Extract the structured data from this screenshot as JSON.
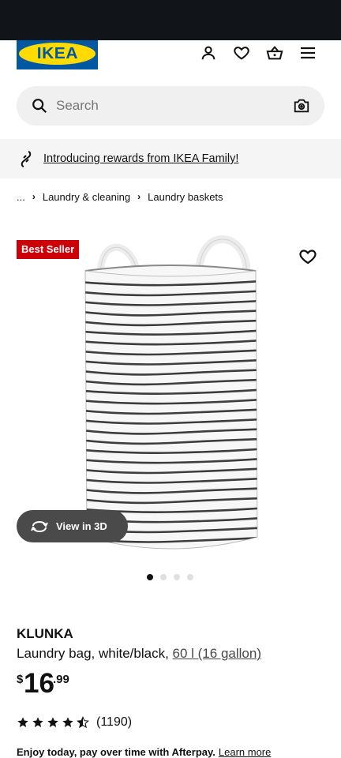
{
  "header": {
    "logo_text": "IKEA",
    "icons": [
      "account-icon",
      "heart-icon",
      "basket-icon",
      "hamburger-menu-icon"
    ]
  },
  "search": {
    "placeholder": "Search"
  },
  "promo": {
    "link_text": "Introducing rewards from IKEA Family!"
  },
  "breadcrumb": {
    "items": [
      "...",
      "Laundry & cleaning",
      "Laundry baskets"
    ],
    "separator": "›"
  },
  "product": {
    "badge": "Best Seller",
    "view_3d_label": "View in 3D",
    "carousel": {
      "count": 4,
      "active": 1
    },
    "name": "KLUNKA",
    "description": "Laundry bag, white/black, ",
    "size_link": "60 l (16 gallon)",
    "price": {
      "currency": "$",
      "integer": "16",
      "decimal": ".99"
    },
    "rating": {
      "stars": 4.5,
      "count": "(1190)"
    },
    "afterpay": {
      "text": "Enjoy today, pay over time with Afterpay.",
      "link": "Learn more"
    }
  },
  "colors": {
    "status_bar": "#111418",
    "ikea_blue": "#0058a3",
    "ikea_yellow": "#ffdb00",
    "badge_red": "#cc0008",
    "search_bg": "#f0f0f0",
    "promo_bg": "#f5f5f5"
  }
}
